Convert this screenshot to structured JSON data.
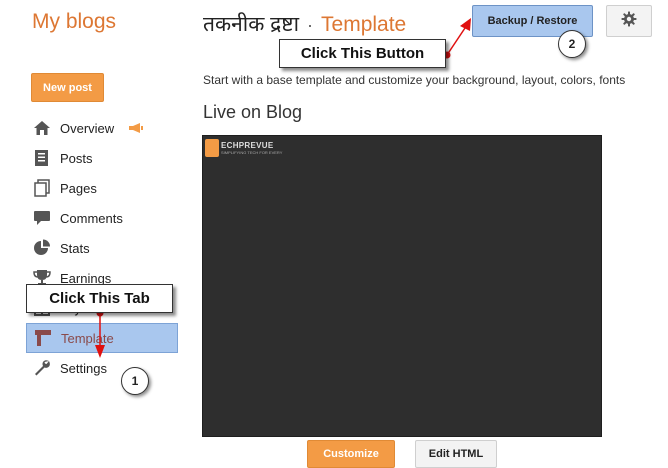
{
  "header": {
    "brand": "My blogs",
    "blog_name": "तकनीक द्रष्टा",
    "separator": "·",
    "section": "Template",
    "backup_button": "Backup / Restore",
    "settings_icon": "gear-icon"
  },
  "sidebar": {
    "new_post": "New post",
    "items": [
      {
        "label": "Overview",
        "icon": "home-icon"
      },
      {
        "label": "Posts",
        "icon": "posts-icon"
      },
      {
        "label": "Pages",
        "icon": "pages-icon"
      },
      {
        "label": "Comments",
        "icon": "comment-icon"
      },
      {
        "label": "Stats",
        "icon": "stats-icon"
      },
      {
        "label": "Earnings",
        "icon": "trophy-icon"
      },
      {
        "label": "Layout",
        "icon": "layout-icon"
      },
      {
        "label": "Template",
        "icon": "template-icon",
        "active": true
      },
      {
        "label": "Settings",
        "icon": "wrench-icon"
      }
    ]
  },
  "main": {
    "intro": "Start with a base template and customize your background, layout, colors, fonts",
    "live_title": "Live on Blog",
    "preview_logo_title": "ECHPREVUE",
    "preview_logo_sub": "SIMPLIFYING TECH FOR EVERY",
    "customize_button": "Customize",
    "edit_html_button": "Edit HTML"
  },
  "annotations": {
    "tab_callout": "Click This Tab",
    "button_callout": "Click This Button",
    "step1": "1",
    "step2": "2"
  },
  "colors": {
    "accent": "#dd7733",
    "button_orange": "#f39b45",
    "highlight_blue": "#a9c7ee",
    "arrow_red": "#e01010"
  }
}
